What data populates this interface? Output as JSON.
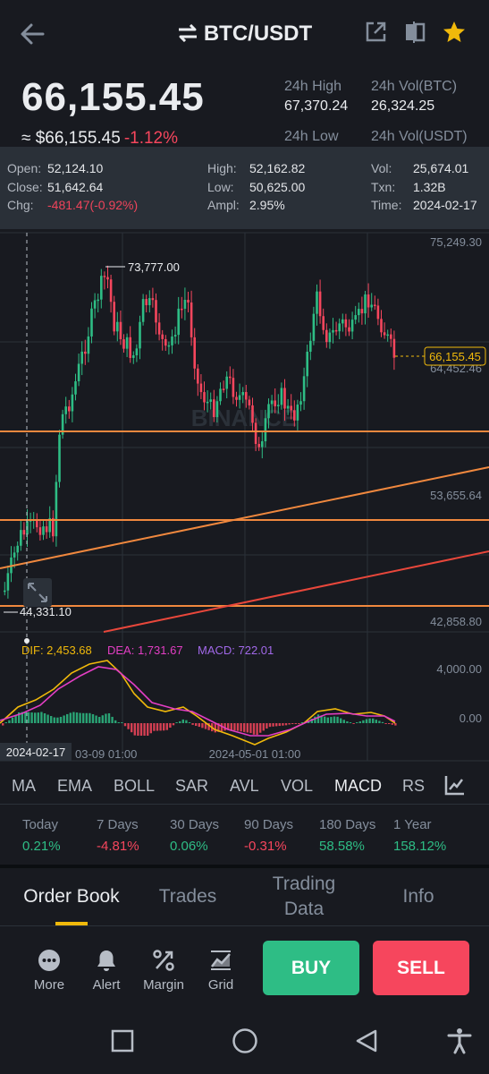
{
  "header": {
    "pair": "BTC/USDT"
  },
  "price": {
    "last": "66,155.45",
    "fiat": "≈ $66,155.45",
    "change": "-1.12%"
  },
  "stats": {
    "high_label": "24h High",
    "high_value": "67,370.24",
    "vol_btc_label": "24h Vol(BTC)",
    "vol_btc_value": "26,324.25",
    "low_label": "24h Low",
    "vol_usdt_label": "24h Vol(USDT)"
  },
  "candle_info": {
    "open_label": "Open:",
    "open_value": "52,124.10",
    "close_label": "Close:",
    "close_value": "51,642.64",
    "chg_label": "Chg:",
    "chg_value": "-481.47(-0.92%)",
    "high_label": "High:",
    "high_value": "52,162.82",
    "low_label": "Low:",
    "low_value": "50,625.00",
    "ampl_label": "Ampl:",
    "ampl_value": "2.95%",
    "vol_label": "Vol:",
    "vol_value": "25,674.01",
    "txn_label": "Txn:",
    "txn_value": "1.32B",
    "time_label": "Time:",
    "time_value": "2024-02-17"
  },
  "chart_data": {
    "type": "candlestick",
    "y_ticks": [
      "75,249.30",
      "64,452.46",
      "53,655.64",
      "42,858.80"
    ],
    "max_label": "73,777.00",
    "min_label": "44,331.10",
    "current_price_label": "66,155.45",
    "watermark": "BINANCE",
    "x_labels": [
      "2024-02-17",
      "03-09 01:00",
      "2024-05-01 01:00"
    ],
    "indicator": {
      "dif_label": "DIF: 2,453.68",
      "dea_label": "DEA: 1,731.67",
      "macd_label": "MACD: 722.01",
      "y_ticks": [
        "4,000.00",
        "0.00"
      ]
    },
    "colors": {
      "up": "#2ebd85",
      "down": "#f6465d",
      "dif": "#f0b90b",
      "dea": "#e33ec4",
      "macd": "#a168e8",
      "trendline_orange": "#f0883e",
      "trendline_red": "#e8473b"
    }
  },
  "indicator_tabs": [
    "MA",
    "EMA",
    "BOLL",
    "SAR",
    "AVL",
    "VOL",
    "MACD",
    "RS"
  ],
  "active_indicator": "MACD",
  "performance": [
    {
      "label": "Today",
      "value": "0.21%",
      "dir": "up"
    },
    {
      "label": "7 Days",
      "value": "-4.81%",
      "dir": "down"
    },
    {
      "label": "30 Days",
      "value": "0.06%",
      "dir": "up"
    },
    {
      "label": "90 Days",
      "value": "-0.31%",
      "dir": "down"
    },
    {
      "label": "180 Days",
      "value": "58.58%",
      "dir": "up"
    },
    {
      "label": "1 Year",
      "value": "158.12%",
      "dir": "up"
    }
  ],
  "bottom_tabs": {
    "order_book": "Order Book",
    "trades": "Trades",
    "trading_data_1": "Trading",
    "trading_data_2": "Data",
    "info": "Info"
  },
  "actions": {
    "more": "More",
    "alert": "Alert",
    "margin": "Margin",
    "grid": "Grid",
    "buy": "BUY",
    "sell": "SELL"
  },
  "icons": [
    "back-arrow-icon",
    "swap-icon",
    "share-icon",
    "compare-icon",
    "star-icon",
    "expand-icon",
    "chart-settings-icon",
    "more-icon",
    "bell-icon",
    "margin-icon",
    "grid-icon",
    "square-nav-icon",
    "circle-nav-icon",
    "triangle-nav-icon",
    "accessibility-icon"
  ]
}
